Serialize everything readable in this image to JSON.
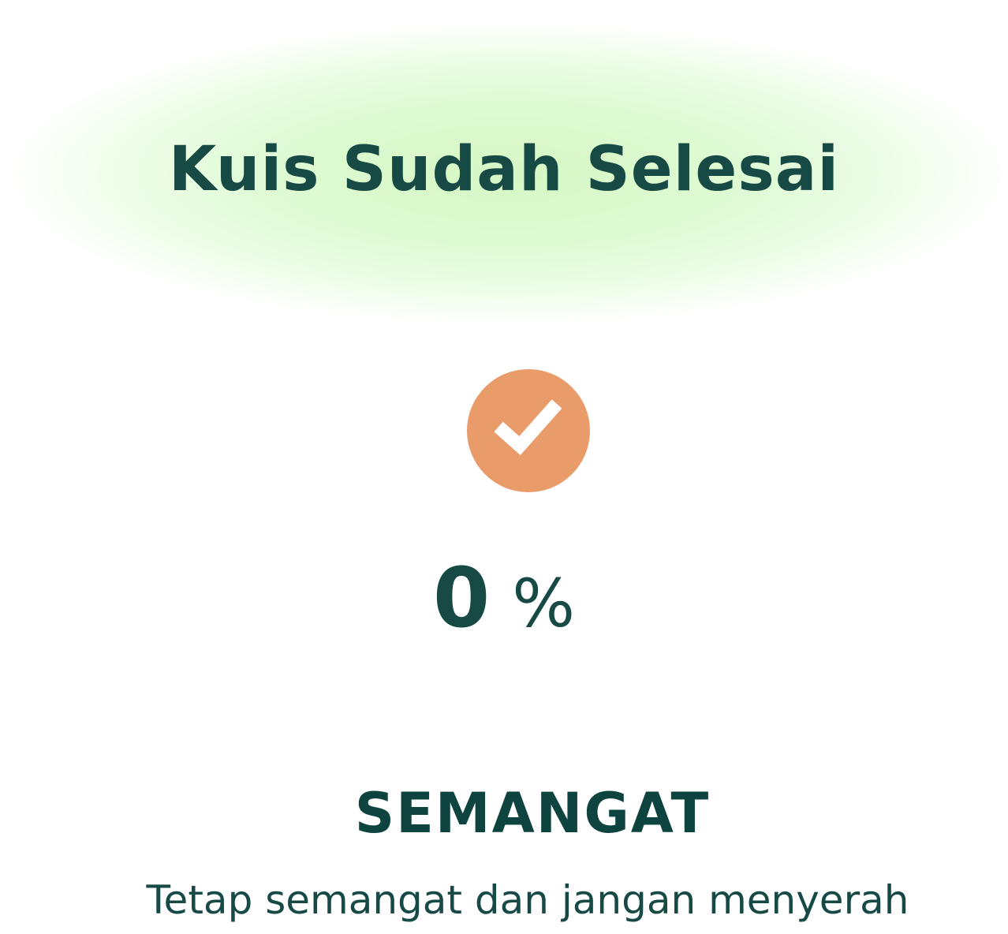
{
  "result": {
    "title": "Kuis Sudah Selesai",
    "icon": "check-circle-icon",
    "score_value": "0",
    "score_unit": "%",
    "status": "SEMANGAT",
    "message": "Tetap semangat dan jangan menyerah"
  },
  "colors": {
    "text": "#174a45",
    "badge": "#ea9b6a",
    "glow": "#d6f7c4",
    "background": "#ffffff"
  }
}
